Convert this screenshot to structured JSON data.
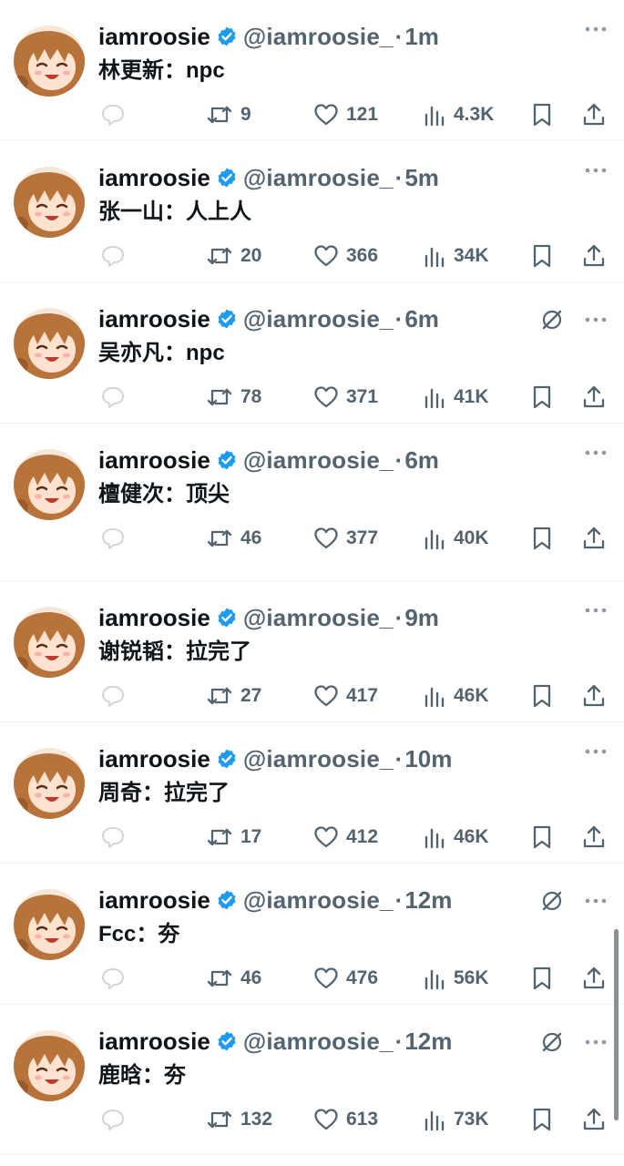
{
  "colors": {
    "text": "#0f1419",
    "muted": "#536471",
    "verified": "#1d9bf0",
    "divider": "#eff3f4",
    "avatar_hair": "#b8733a",
    "avatar_skin": "#fde3cf"
  },
  "icons": {
    "verified": "verified-badge-icon",
    "more": "more-horizontal-icon",
    "grok": "grok-icon",
    "reply": "reply-bubble-icon",
    "retweet": "retweet-icon",
    "like": "heart-icon",
    "views": "views-bar-chart-icon",
    "bookmark": "bookmark-icon",
    "share": "share-upload-icon"
  },
  "tweets": [
    {
      "name": "iamroosie",
      "handle": "@iamroosie_",
      "sep": "·",
      "time": "1m",
      "text": "林更新：npc",
      "retweets": "9",
      "likes": "121",
      "views": "4.3K",
      "grok": false
    },
    {
      "name": "iamroosie",
      "handle": "@iamroosie_",
      "sep": "·",
      "time": "5m",
      "text": "张一山：人上人",
      "retweets": "20",
      "likes": "366",
      "views": "34K",
      "grok": false
    },
    {
      "name": "iamroosie",
      "handle": "@iamroosie_",
      "sep": "·",
      "time": "6m",
      "text": "吴亦凡：npc",
      "retweets": "78",
      "likes": "371",
      "views": "41K",
      "grok": true
    },
    {
      "name": "iamroosie",
      "handle": "@iamroosie_",
      "sep": "·",
      "time": "6m",
      "text": "檀健次：顶尖",
      "retweets": "46",
      "likes": "377",
      "views": "40K",
      "grok": false
    },
    {
      "name": "iamroosie",
      "handle": "@iamroosie_",
      "sep": "·",
      "time": "9m",
      "text": "谢锐韬：拉完了",
      "retweets": "27",
      "likes": "417",
      "views": "46K",
      "grok": false
    },
    {
      "name": "iamroosie",
      "handle": "@iamroosie_",
      "sep": "·",
      "time": "10m",
      "text": "周奇：拉完了",
      "retweets": "17",
      "likes": "412",
      "views": "46K",
      "grok": false
    },
    {
      "name": "iamroosie",
      "handle": "@iamroosie_",
      "sep": "·",
      "time": "12m",
      "text": "Fcc：夯",
      "retweets": "46",
      "likes": "476",
      "views": "56K",
      "grok": true
    },
    {
      "name": "iamroosie",
      "handle": "@iamroosie_",
      "sep": "·",
      "time": "12m",
      "text": "鹿晗：夯",
      "retweets": "132",
      "likes": "613",
      "views": "73K",
      "grok": true
    }
  ]
}
